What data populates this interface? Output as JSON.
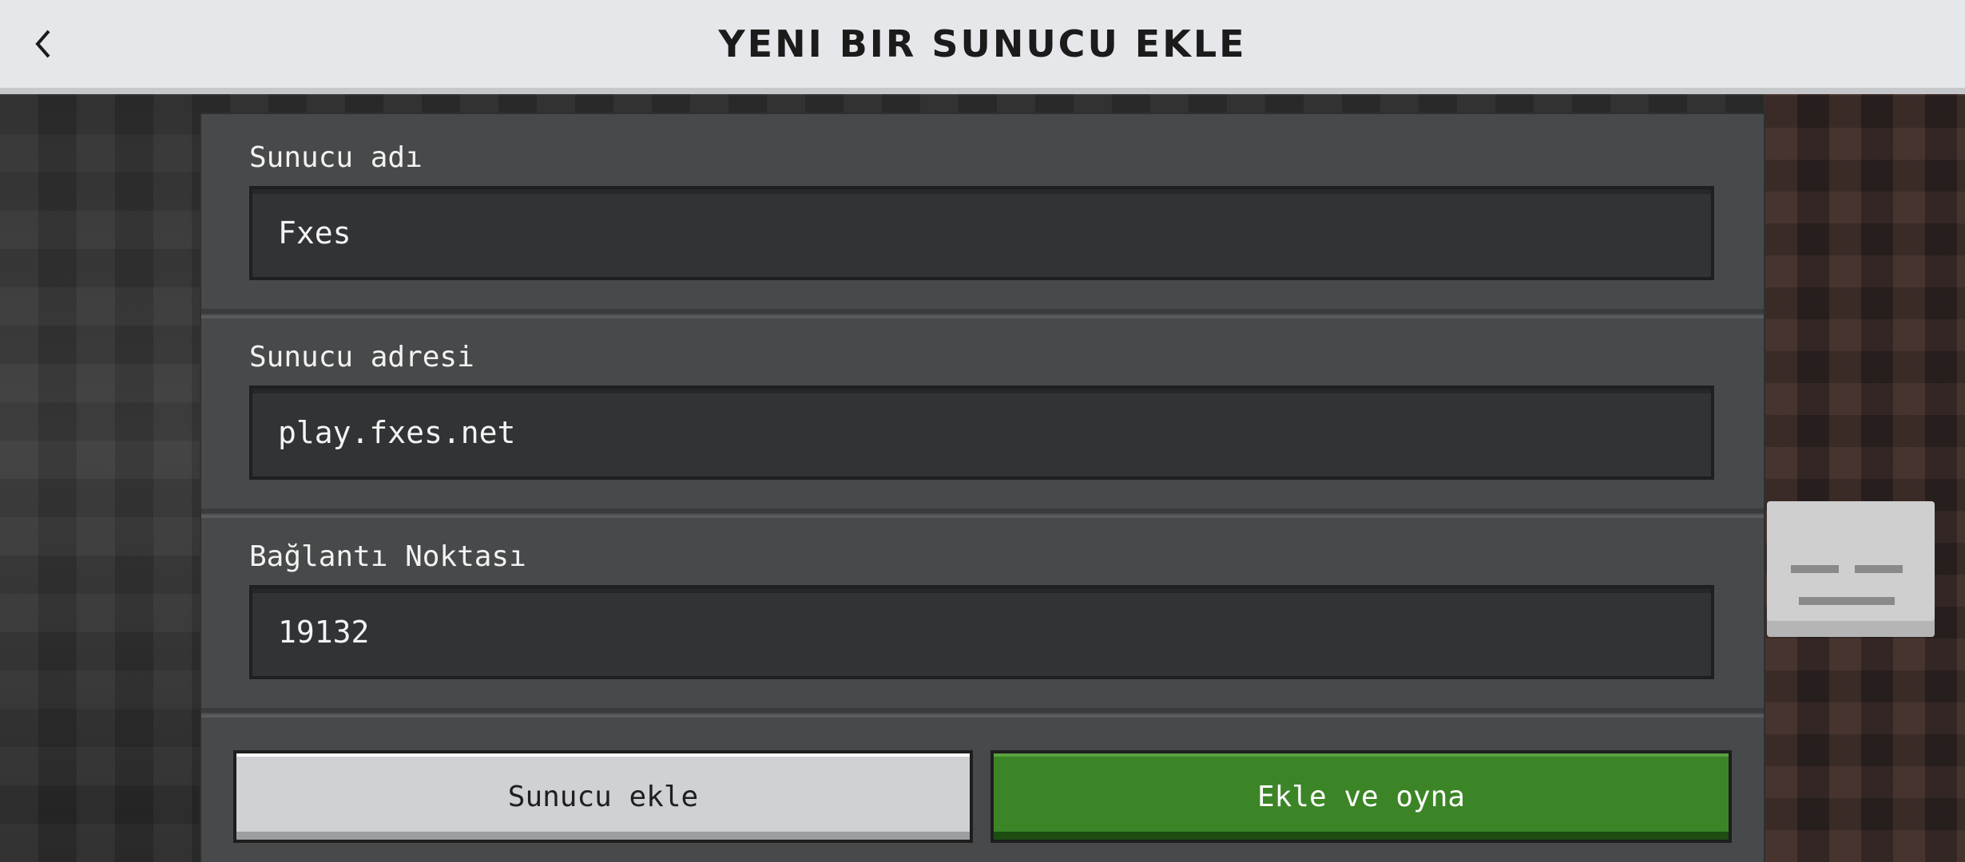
{
  "header": {
    "title": "YENI BIR SUNUCU EKLE",
    "back_icon": "chevron-left-icon"
  },
  "form": {
    "fields": [
      {
        "label": "Sunucu adı",
        "value": "Fxes"
      },
      {
        "label": "Sunucu adresi",
        "value": "play.fxes.net"
      },
      {
        "label": "Bağlantı Noktası",
        "value": "19132"
      }
    ]
  },
  "buttons": {
    "add_label": "Sunucu ekle",
    "add_and_play_label": "Ekle ve oyna"
  },
  "colors": {
    "header_bg": "#e5e7ea",
    "panel_bg": "#48494a",
    "field_bg": "#313335",
    "secondary_button": "#d0d1d4",
    "primary_button": "#3c8527"
  }
}
